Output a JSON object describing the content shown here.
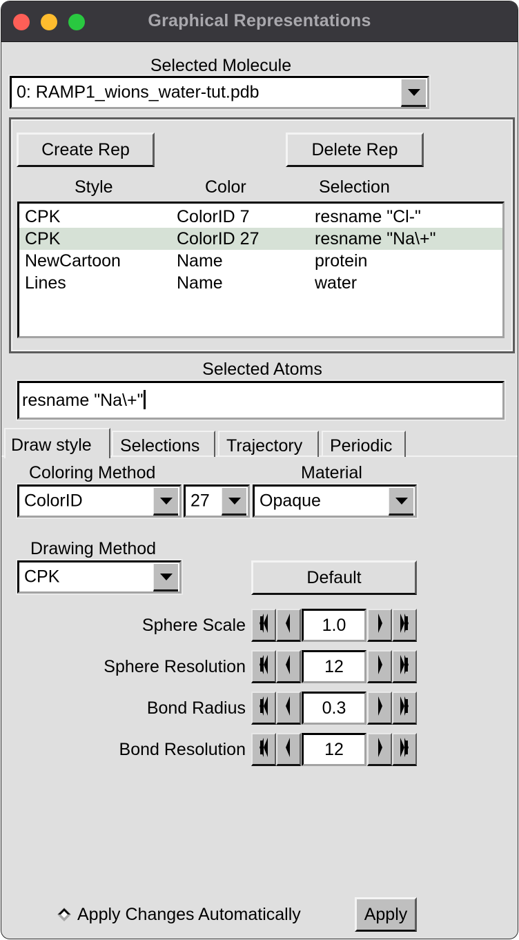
{
  "window": {
    "title": "Graphical Representations",
    "traffic_lights": [
      "close-button",
      "minimize-button",
      "zoom-button"
    ]
  },
  "molecule": {
    "label": "Selected Molecule",
    "value": "0: RAMP1_wions_water-tut.pdb"
  },
  "reps": {
    "create_label": "Create Rep",
    "delete_label": "Delete Rep",
    "columns": [
      "Style",
      "Color",
      "Selection"
    ],
    "rows": [
      {
        "style": "CPK",
        "color": "ColorID 7",
        "selection": "resname \"Cl-\"",
        "selected": false
      },
      {
        "style": "CPK",
        "color": "ColorID 27",
        "selection": "resname \"Na\\+\"",
        "selected": true
      },
      {
        "style": "NewCartoon",
        "color": "Name",
        "selection": "protein",
        "selected": false
      },
      {
        "style": "Lines",
        "color": "Name",
        "selection": "water",
        "selected": false
      }
    ],
    "selected_row_color": "#d6e1d6"
  },
  "selected_atoms": {
    "label": "Selected Atoms",
    "value": "resname \"Na\\+\""
  },
  "tabs": [
    {
      "label": "Draw style",
      "active": true
    },
    {
      "label": "Selections",
      "active": false
    },
    {
      "label": "Trajectory",
      "active": false
    },
    {
      "label": "Periodic",
      "active": false
    }
  ],
  "draw_style": {
    "coloring_method_label": "Coloring Method",
    "coloring_method": "ColorID",
    "color_id": "27",
    "material_label": "Material",
    "material": "Opaque",
    "drawing_method_label": "Drawing Method",
    "drawing_method": "CPK",
    "default_label": "Default",
    "params": [
      {
        "label": "Sphere Scale",
        "value": "1.0"
      },
      {
        "label": "Sphere Resolution",
        "value": "12"
      },
      {
        "label": "Bond Radius",
        "value": "0.3"
      },
      {
        "label": "Bond Resolution",
        "value": "12"
      }
    ]
  },
  "footer": {
    "auto_apply_label": "Apply Changes Automatically",
    "apply_label": "Apply"
  }
}
